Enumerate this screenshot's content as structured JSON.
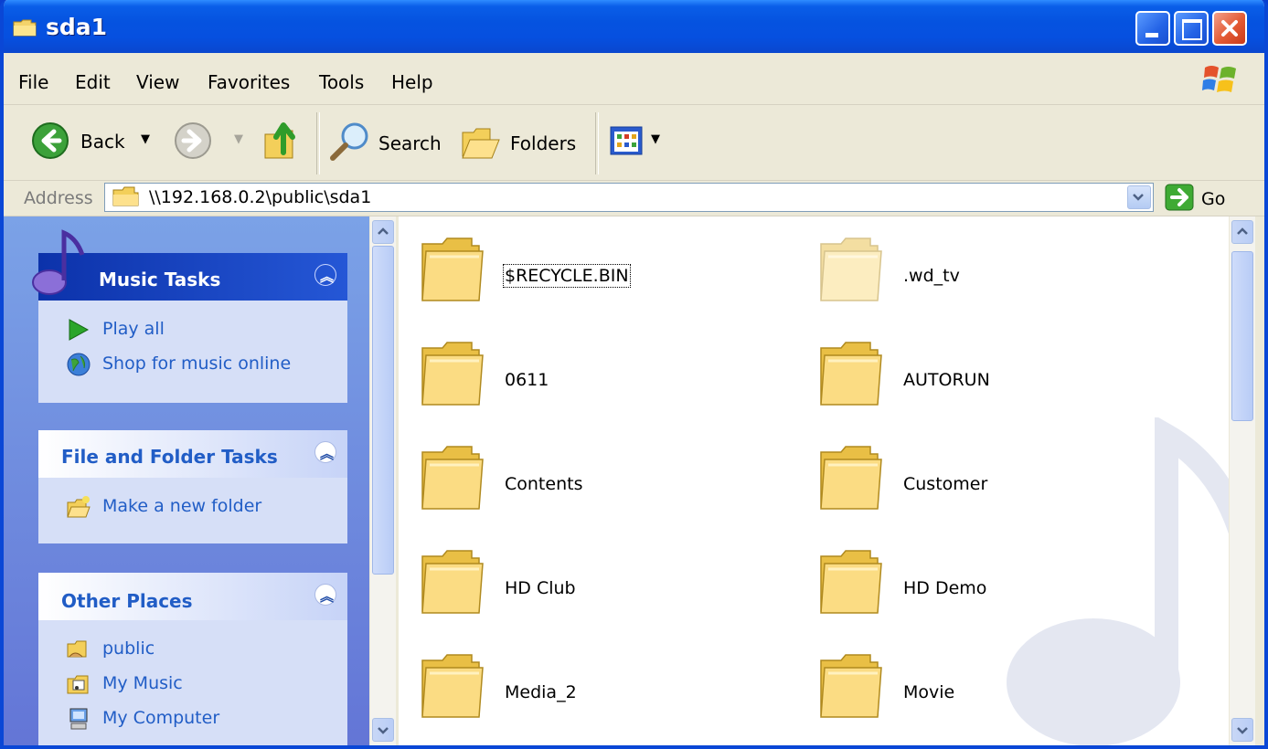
{
  "window": {
    "title": "sda1"
  },
  "menubar": {
    "items": [
      "File",
      "Edit",
      "View",
      "Favorites",
      "Tools",
      "Help"
    ]
  },
  "toolbar": {
    "back_label": "Back",
    "search_label": "Search",
    "folders_label": "Folders"
  },
  "address": {
    "label": "Address",
    "value": "\\\\192.168.0.2\\public\\sda1",
    "go_label": "Go"
  },
  "task_pane": {
    "music_tasks": {
      "title": "Music Tasks",
      "items": [
        "Play all",
        "Shop for music online"
      ]
    },
    "file_folder_tasks": {
      "title": "File and Folder Tasks",
      "items": [
        "Make a new folder"
      ]
    },
    "other_places": {
      "title": "Other Places",
      "items": [
        "public",
        "My Music",
        "My Computer"
      ]
    }
  },
  "folders": [
    {
      "name": "$RECYCLE.BIN",
      "selected": true,
      "hidden": false
    },
    {
      "name": ".wd_tv",
      "selected": false,
      "hidden": true
    },
    {
      "name": "0611",
      "selected": false,
      "hidden": false
    },
    {
      "name": "AUTORUN",
      "selected": false,
      "hidden": false
    },
    {
      "name": "Contents",
      "selected": false,
      "hidden": false
    },
    {
      "name": "Customer",
      "selected": false,
      "hidden": false
    },
    {
      "name": "HD Club",
      "selected": false,
      "hidden": false
    },
    {
      "name": "HD Demo",
      "selected": false,
      "hidden": false
    },
    {
      "name": "Media_2",
      "selected": false,
      "hidden": false
    },
    {
      "name": "Movie",
      "selected": false,
      "hidden": false
    }
  ],
  "colors": {
    "titlebar": "#0a5ee8",
    "task_link": "#215dc6",
    "task_pane_bg": "#6e8ede"
  }
}
